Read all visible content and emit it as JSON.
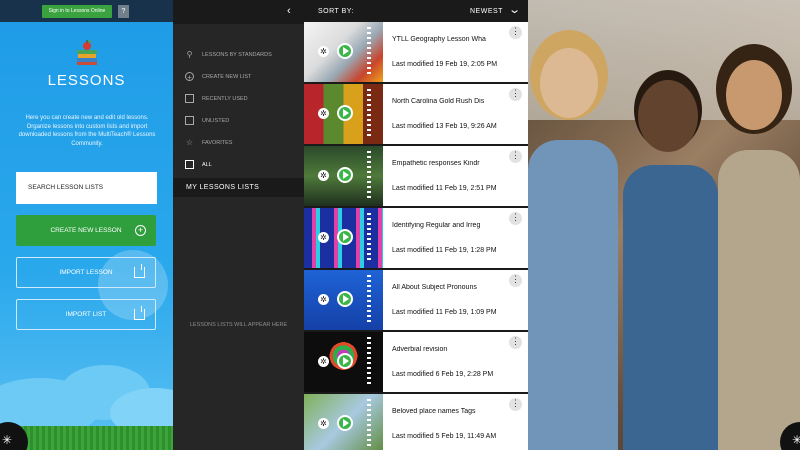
{
  "top_strip": {
    "signin_label": "Sign in to Lessons Online",
    "help_label": "?"
  },
  "left": {
    "title": "LESSONS",
    "description": "Here you can create new and edit old lessons. Organize lessons into custom lists and import downloaded lessons from the MultiTeach® Lessons Community.",
    "search_label": "SEARCH LESSON LISTS",
    "create_label": "CREATE NEW LESSON",
    "import_lesson_label": "IMPORT LESSON",
    "import_list_label": "IMPORT LIST"
  },
  "topbar": {
    "back": "‹",
    "sort_label": "SORT BY:",
    "sort_value": "NEWEST"
  },
  "nav": {
    "items": [
      {
        "label": "LESSONS BY STANDARDS",
        "icon": "pin-icon"
      },
      {
        "label": "CREATE NEW LIST",
        "icon": "plus-circle-icon"
      },
      {
        "label": "RECENTLY USED",
        "icon": "list-box-icon"
      },
      {
        "label": "UNLISTED",
        "icon": "tray-icon"
      },
      {
        "label": "FAVORITES",
        "icon": "star-icon"
      },
      {
        "label": "ALL",
        "icon": "grid-box-icon"
      }
    ],
    "my_lists_label": "MY LESSONS LISTS",
    "empty_label": "LESSONS LISTS WILL APPEAR HERE"
  },
  "lessons": [
    {
      "title": "YTLL Geography Lesson Wha",
      "modified": "Last modified 19 Feb 19, 2:05 PM"
    },
    {
      "title": "North Carolina Gold Rush Dis",
      "modified": "Last modified 13 Feb 19, 9:26 AM"
    },
    {
      "title": "Empathetic responses  Kindr",
      "modified": "Last modified 11 Feb 19, 2:51 PM"
    },
    {
      "title": "Identifying Regular and Irreg",
      "modified": "Last modified 11 Feb 19, 1:28 PM"
    },
    {
      "title": "All About Subject Pronouns",
      "modified": "Last modified 11 Feb 19, 1:09 PM"
    },
    {
      "title": "Adverbial revision",
      "modified": "Last modified 6 Feb 19, 2:28 PM"
    },
    {
      "title": "Beloved place names Tags",
      "modified": "Last modified 5 Feb 19, 11:49 AM"
    }
  ],
  "colors": {
    "accent_blue": "#1e9be6",
    "create_green": "#2f9e3c",
    "play_green": "#3bb54a",
    "nav_dark": "#262626"
  }
}
